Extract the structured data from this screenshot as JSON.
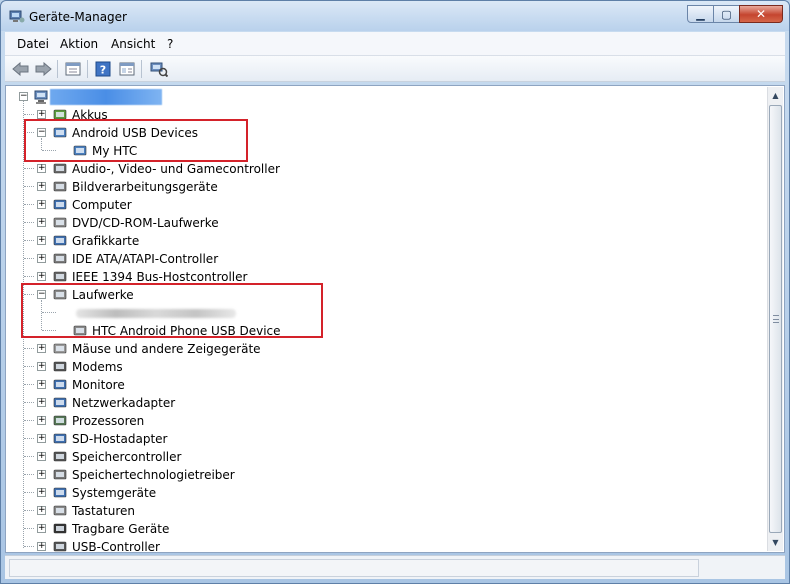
{
  "window": {
    "title": "Geräte-Manager",
    "controls": {
      "minimize": "▁",
      "maximize": "▢",
      "close": "✕"
    }
  },
  "menu": [
    "Datei",
    "Aktion",
    "Ansicht",
    "?"
  ],
  "toolbar_icons": [
    "back-arrow-icon",
    "forward-arrow-icon",
    "properties-pane-icon",
    "help-icon",
    "view-pane-icon",
    "scan-hardware-icon"
  ],
  "tree": {
    "root": {
      "icon": "computer-icon"
    },
    "categories": [
      {
        "label": "Akkus",
        "icon": "battery-icon",
        "expanded": false
      },
      {
        "label": "Android USB Devices",
        "icon": "android-device-icon",
        "expanded": true,
        "children": [
          "My HTC"
        ]
      },
      {
        "label": "Audio-, Video- und Gamecontroller",
        "icon": "speaker-icon",
        "expanded": false
      },
      {
        "label": "Bildverarbeitungsgeräte",
        "icon": "camera-icon",
        "expanded": false
      },
      {
        "label": "Computer",
        "icon": "monitor-icon",
        "expanded": false
      },
      {
        "label": "DVD/CD-ROM-Laufwerke",
        "icon": "disc-icon",
        "expanded": false
      },
      {
        "label": "Grafikkarte",
        "icon": "display-adapter-icon",
        "expanded": false
      },
      {
        "label": "IDE ATA/ATAPI-Controller",
        "icon": "ide-controller-icon",
        "expanded": false
      },
      {
        "label": "IEEE 1394 Bus-Hostcontroller",
        "icon": "firewire-icon",
        "expanded": false
      },
      {
        "label": "Laufwerke",
        "icon": "drive-icon",
        "expanded": true,
        "children": [
          "HTC Android Phone USB Device"
        ]
      },
      {
        "label": "Mäuse und andere Zeigegeräte",
        "icon": "mouse-icon",
        "expanded": false
      },
      {
        "label": "Modems",
        "icon": "modem-icon",
        "expanded": false
      },
      {
        "label": "Monitore",
        "icon": "monitor-icon",
        "expanded": false
      },
      {
        "label": "Netzwerkadapter",
        "icon": "network-icon",
        "expanded": false
      },
      {
        "label": "Prozessoren",
        "icon": "processor-icon",
        "expanded": false
      },
      {
        "label": "SD-Hostadapter",
        "icon": "sd-card-icon",
        "expanded": false
      },
      {
        "label": "Speichercontroller",
        "icon": "storage-controller-icon",
        "expanded": false
      },
      {
        "label": "Speichertechnologietreiber",
        "icon": "storage-driver-icon",
        "expanded": false
      },
      {
        "label": "Systemgeräte",
        "icon": "system-device-icon",
        "expanded": false
      },
      {
        "label": "Tastaturen",
        "icon": "keyboard-icon",
        "expanded": false
      },
      {
        "label": "Tragbare Geräte",
        "icon": "portable-device-icon",
        "expanded": false
      },
      {
        "label": "USB-Controller",
        "icon": "usb-icon",
        "expanded": false
      }
    ]
  },
  "colors": {
    "highlight_border": "#d4222a",
    "selection": "#4a8ee6"
  }
}
